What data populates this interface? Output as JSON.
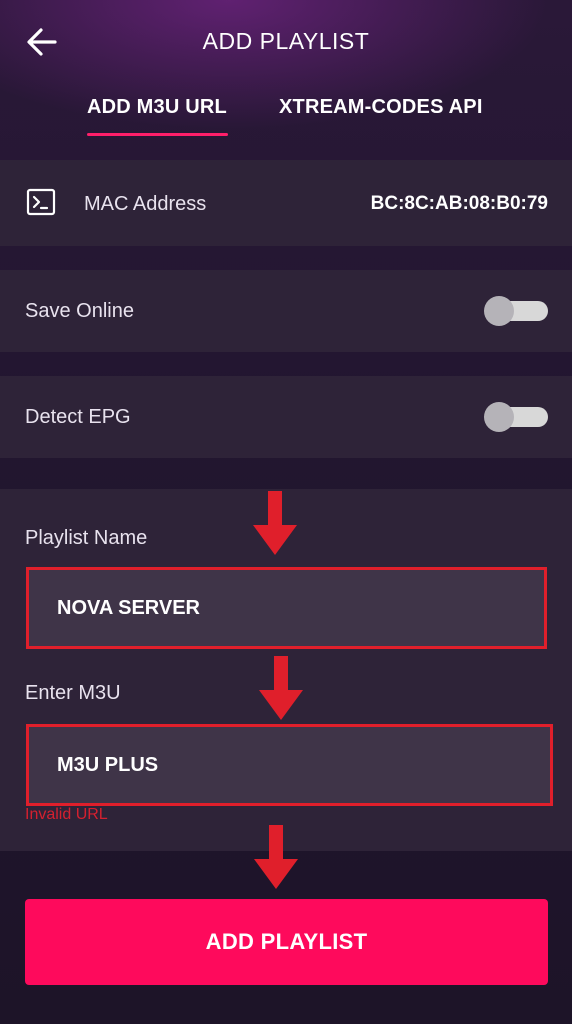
{
  "header": {
    "title": "ADD PLAYLIST",
    "back_icon": "arrow-left-icon"
  },
  "tabs": [
    {
      "label": "ADD M3U URL",
      "active": true
    },
    {
      "label": "XTREAM-CODES API",
      "active": false
    }
  ],
  "mac": {
    "icon": "terminal-icon",
    "label": "MAC Address",
    "value": "BC:8C:AB:08:B0:79"
  },
  "settings": {
    "save_online": {
      "label": "Save Online",
      "enabled": false
    },
    "detect_epg": {
      "label": "Detect EPG",
      "enabled": false
    }
  },
  "form": {
    "playlist_name": {
      "label": "Playlist Name",
      "value": "NOVA SERVER"
    },
    "m3u": {
      "label": "Enter M3U",
      "value": "M3U PLUS",
      "error": "Invalid URL"
    }
  },
  "submit_label": "ADD PLAYLIST",
  "colors": {
    "accent": "#fe0a5c",
    "annotation_red": "#e01f2b",
    "panel": "#2e2338",
    "background": "#221630"
  }
}
